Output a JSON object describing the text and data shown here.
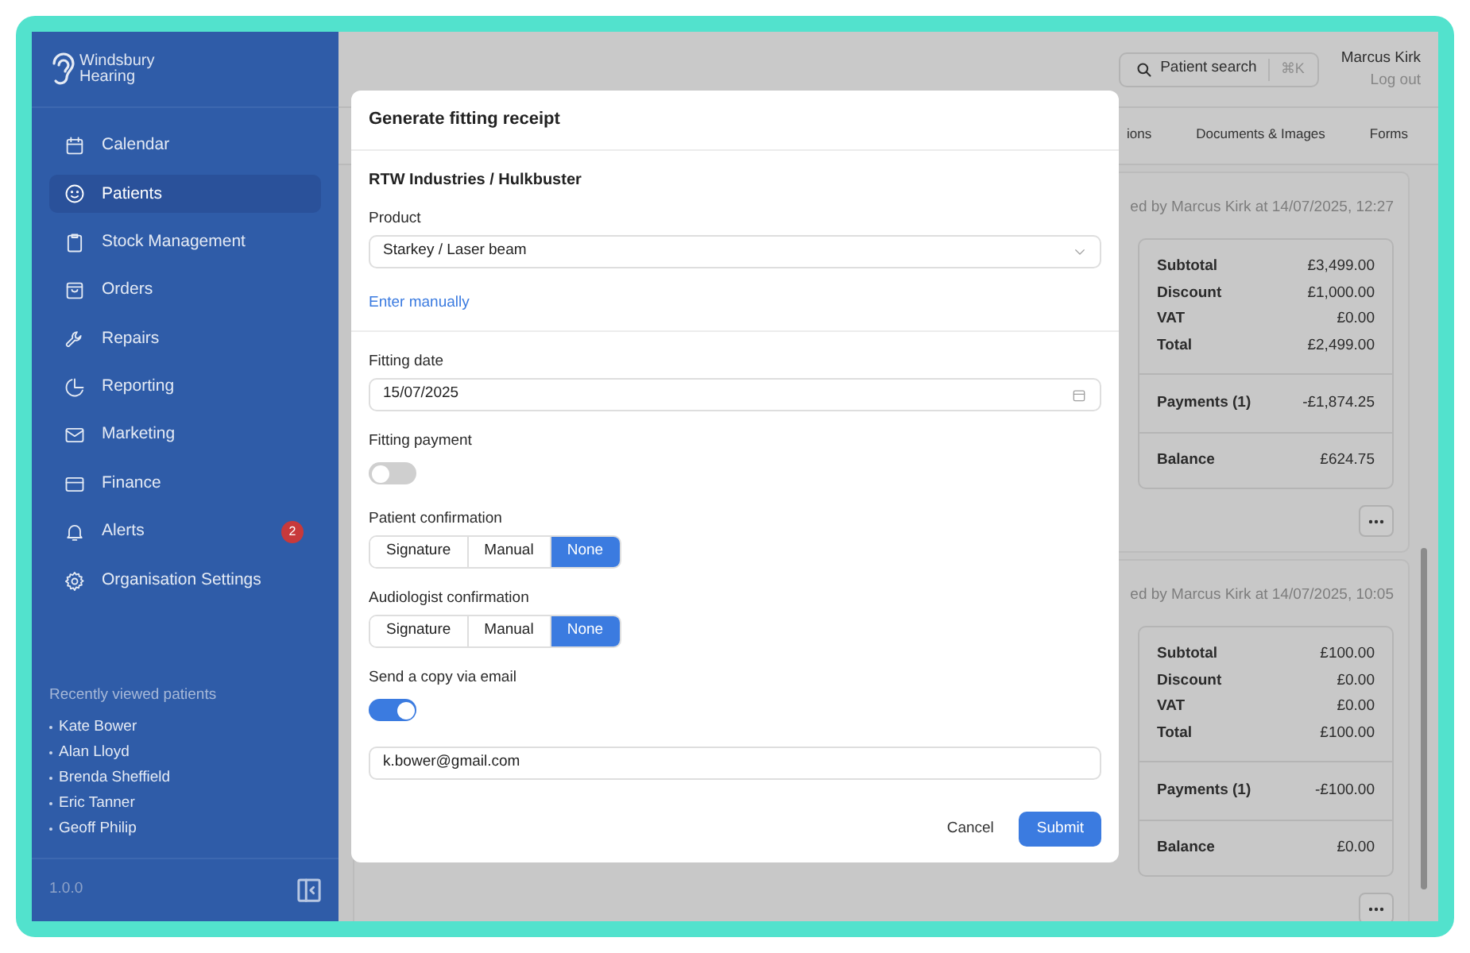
{
  "sidebar": {
    "logo": [
      "Windsbury",
      "Hearing"
    ],
    "items": [
      {
        "label": "Calendar",
        "selected": false
      },
      {
        "label": "Patients",
        "selected": true
      },
      {
        "label": "Stock Management",
        "selected": false
      },
      {
        "label": "Orders",
        "selected": false
      },
      {
        "label": "Repairs",
        "selected": false
      },
      {
        "label": "Reporting",
        "selected": false
      },
      {
        "label": "Marketing",
        "selected": false
      },
      {
        "label": "Finance",
        "selected": false
      },
      {
        "label": "Alerts",
        "selected": false,
        "badge": "2"
      },
      {
        "label": "Organisation Settings",
        "selected": false
      }
    ],
    "recent": {
      "title": "Recently viewed patients",
      "patients": [
        "Kate Bower",
        "Alan Lloyd",
        "Brenda Sheffield",
        "Eric Tanner",
        "Geoff Philip"
      ]
    },
    "version": "1.0.0"
  },
  "header": {
    "search": {
      "label": "Patient search",
      "shortcut": "⌘K"
    },
    "user": "Marcus Kirk",
    "logout": "Log out"
  },
  "tabs": [
    {
      "label": "ions",
      "selected": false
    },
    {
      "label": "Documents & Images",
      "selected": false
    },
    {
      "label": "Forms",
      "selected": false
    }
  ],
  "receipts": [
    {
      "caption": "ed by Marcus Kirk at 14/07/2025, 12:27",
      "totals": [
        {
          "label": "Subtotal",
          "value": "£3,499.00"
        },
        {
          "label": "Discount",
          "value": "£1,000.00"
        },
        {
          "label": "VAT",
          "value": "£0.00"
        },
        {
          "label": "Total",
          "value": "£2,499.00"
        }
      ],
      "payments": {
        "label": "Payments (1)",
        "value": "-£1,874.25"
      },
      "balance": {
        "label": "Balance",
        "value": "£624.75"
      }
    },
    {
      "caption": "ed by Marcus Kirk at 14/07/2025, 10:05",
      "totals": [
        {
          "label": "Subtotal",
          "value": "£100.00"
        },
        {
          "label": "Discount",
          "value": "£0.00"
        },
        {
          "label": "VAT",
          "value": "£0.00"
        },
        {
          "label": "Total",
          "value": "£100.00"
        }
      ],
      "payments": {
        "label": "Payments (1)",
        "value": "-£100.00"
      },
      "balance": {
        "label": "Balance",
        "value": "£0.00"
      }
    }
  ],
  "modal": {
    "title": "Generate fitting receipt",
    "subtitle": "RTW Industries / Hulkbuster",
    "product": {
      "label": "Product",
      "value": "Starkey / Laser beam"
    },
    "enter_manually": "Enter manually",
    "fields": [
      {
        "kind": "date",
        "label": "Fitting date",
        "value": "15/07/2025"
      },
      {
        "kind": "toggle",
        "label": "Fitting payment",
        "on": false
      },
      {
        "kind": "segmented",
        "label": "Patient confirmation",
        "options": [
          {
            "label": "Signature",
            "selected": false
          },
          {
            "label": "Manual",
            "selected": false
          },
          {
            "label": "None",
            "selected": true
          }
        ]
      },
      {
        "kind": "segmented",
        "label": "Audiologist confirmation",
        "options": [
          {
            "label": "Signature",
            "selected": false
          },
          {
            "label": "Manual",
            "selected": false
          },
          {
            "label": "None",
            "selected": true
          }
        ]
      },
      {
        "kind": "toggle",
        "label": "Send a copy via email",
        "on": true
      },
      {
        "kind": "text",
        "value": "k.bower@gmail.com"
      }
    ],
    "buttons": [
      {
        "kind": "secondary",
        "label": "Cancel"
      },
      {
        "kind": "primary",
        "label": "Submit"
      }
    ]
  }
}
